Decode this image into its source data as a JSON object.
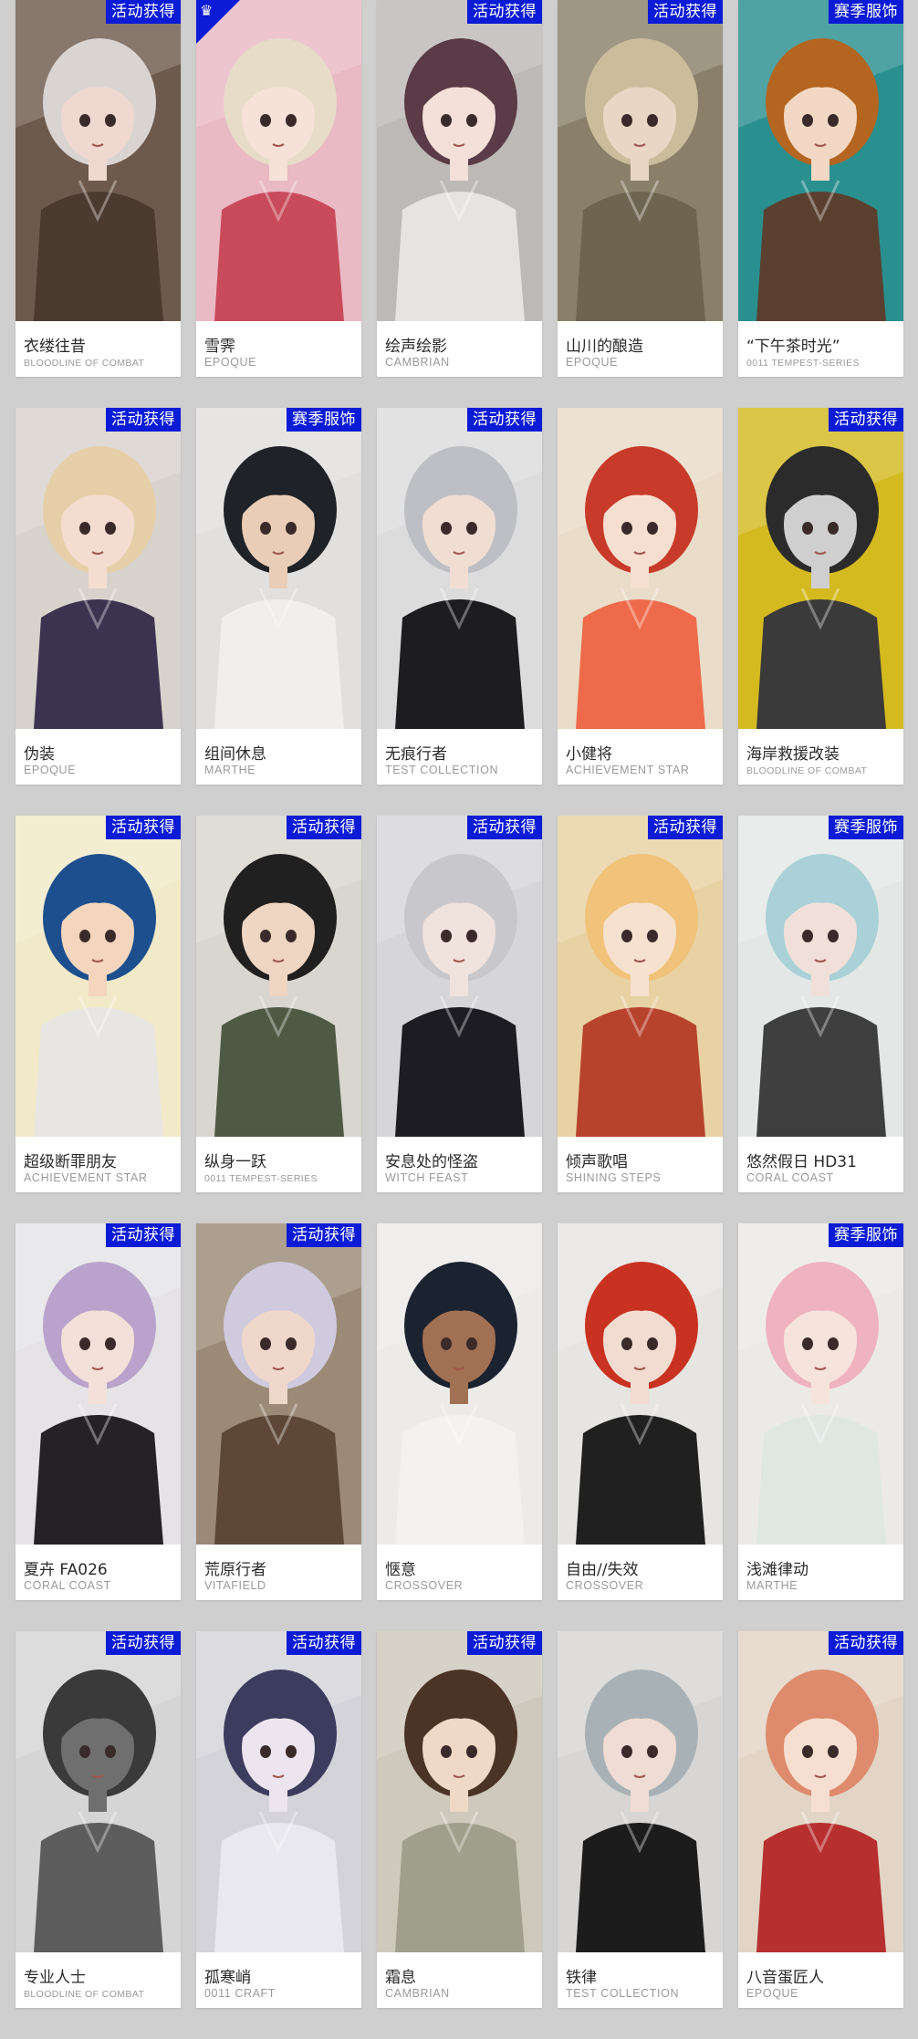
{
  "badges": {
    "event": "活动获得",
    "season": "赛季服饰"
  },
  "skins": [
    {
      "name": "衣缕往昔",
      "series": "BLOODLINE OF COMBAT",
      "badge": "活动获得",
      "bg": "#6e5a4c",
      "hair": "#d9d4d2",
      "outfit": "#4b3a30",
      "skin": "#efd8cf"
    },
    {
      "name": "雪霁",
      "series": "EPOQUE",
      "badge": "",
      "corner": true,
      "bg": "#e9b9c4",
      "hair": "#e6dcc8",
      "outfit": "#c94a5a",
      "skin": "#f6e2d8"
    },
    {
      "name": "绘声绘影",
      "series": "CAMBRIAN",
      "badge": "活动获得",
      "bg": "#bdb9b7",
      "hair": "#5a3b47",
      "outfit": "#e7e3e3",
      "skin": "#f4e0d8"
    },
    {
      "name": "山川的酿造",
      "series": "EPOQUE",
      "badge": "活动获得",
      "bg": "#8a8069",
      "hair": "#cbbd9c",
      "outfit": "#6f6450",
      "skin": "#ead6c4"
    },
    {
      "name": "“下午茶时光”",
      "series": "0011 TEMPEST-SERIES",
      "badge": "赛季服饰",
      "bg": "#2a8f8f",
      "hair": "#b4651f",
      "outfit": "#5b4030",
      "skin": "#f2d8c4"
    },
    {
      "name": "伪装",
      "series": "EPOQUE",
      "badge": "活动获得",
      "bg": "#d8d2cc",
      "hair": "#e6cfa8",
      "outfit": "#3b3450",
      "skin": "#f4ddd0"
    },
    {
      "name": "组间休息",
      "series": "MARTHE",
      "badge": "赛季服饰",
      "bg": "#e2e0de",
      "hair": "#1f2226",
      "outfit": "#f1efec",
      "skin": "#e9cdb7"
    },
    {
      "name": "无痕行者",
      "series": "TEST COLLECTION",
      "badge": "活动获得",
      "bg": "#dcdcdc",
      "hair": "#bdbfc4",
      "outfit": "#1d1d20",
      "skin": "#f1ded3"
    },
    {
      "name": "小健将",
      "series": "ACHIEVEMENT STAR",
      "badge": "",
      "bg": "#e9dcc8",
      "hair": "#c83a2a",
      "outfit": "#ee6a4a",
      "skin": "#f6dfd0"
    },
    {
      "name": "海岸救援改装",
      "series": "BLOODLINE OF COMBAT",
      "badge": "活动获得",
      "bg": "#d4ba1f",
      "hair": "#2b2b2b",
      "outfit": "#3a3a3a",
      "skin": "#cfcfcf"
    },
    {
      "name": "超级断罪朋友",
      "series": "ACHIEVEMENT STAR",
      "badge": "活动获得",
      "bg": "#f1e9c8",
      "hair": "#1d4f8e",
      "outfit": "#e8e6e2",
      "skin": "#f4d5be"
    },
    {
      "name": "纵身一跃",
      "series": "0011 TEMPEST-SERIES",
      "badge": "活动获得",
      "bg": "#d9d6cf",
      "hair": "#202020",
      "outfit": "#4f5a45",
      "skin": "#efd6c3"
    },
    {
      "name": "安息处的怪盗",
      "series": "WITCH FEAST",
      "badge": "活动获得",
      "bg": "#d6d6d8",
      "hair": "#c8c8cc",
      "outfit": "#1c1c22",
      "skin": "#f0e2dc"
    },
    {
      "name": "倾声歌唱",
      "series": "SHINING STEPS",
      "badge": "活动获得",
      "bg": "#e8d2a4",
      "hair": "#f0c27a",
      "outfit": "#b8432c",
      "skin": "#f6e1cf"
    },
    {
      "name": "悠然假日 HD31",
      "series": "CORAL COAST",
      "badge": "赛季服饰",
      "bg": "#e3e8e6",
      "hair": "#a9d1d7",
      "outfit": "#3f3f3f",
      "skin": "#f1e0d9"
    },
    {
      "name": "夏卉 FA026",
      "series": "CORAL COAST",
      "badge": "活动获得",
      "bg": "#e5e3e6",
      "hair": "#b9a3cc",
      "outfit": "#252227",
      "skin": "#f3e0d8"
    },
    {
      "name": "荒原行者",
      "series": "VITAFIELD",
      "badge": "活动获得",
      "bg": "#9a8a76",
      "hair": "#cfcadd",
      "outfit": "#5e4737",
      "skin": "#efd8cb"
    },
    {
      "name": "惬意",
      "series": "CROSSOVER",
      "badge": "",
      "bg": "#ecebe8",
      "hair": "#1b2230",
      "outfit": "#f3f2ef",
      "skin": "#a27052"
    },
    {
      "name": "自由//失效",
      "series": "CROSSOVER",
      "badge": "",
      "bg": "#e7e5e2",
      "hair": "#c93120",
      "outfit": "#202020",
      "skin": "#f2dcd2"
    },
    {
      "name": "浅滩律动",
      "series": "MARTHE",
      "badge": "赛季服饰",
      "bg": "#eceae6",
      "hair": "#efb2bf",
      "outfit": "#dfe7e3",
      "skin": "#f6e4dc"
    },
    {
      "name": "专业人士",
      "series": "BLOODLINE OF COMBAT",
      "badge": "活动获得",
      "bg": "#d5d5d5",
      "hair": "#3a3a3a",
      "outfit": "#5d5d5d",
      "skin": "#6f6f6f"
    },
    {
      "name": "孤寒峭",
      "series": "0011 CRAFT",
      "badge": "活动获得",
      "bg": "#d4d3da",
      "hair": "#3c3c5e",
      "outfit": "#e9e8ee",
      "skin": "#ece5ef"
    },
    {
      "name": "霜息",
      "series": "CAMBRIAN",
      "badge": "活动获得",
      "bg": "#cfc8bc",
      "hair": "#4b3426",
      "outfit": "#9fa08b",
      "skin": "#efd8c6"
    },
    {
      "name": "铁律",
      "series": "TEST COLLECTION",
      "badge": "",
      "bg": "#d7d6d4",
      "hair": "#a8b1b6",
      "outfit": "#1c1c1c",
      "skin": "#efdcd4"
    },
    {
      "name": "八音蛋匠人",
      "series": "EPOQUE",
      "badge": "活动获得",
      "bg": "#e2d5c5",
      "hair": "#de8a6d",
      "outfit": "#b72f2f",
      "skin": "#f6dfd0"
    }
  ]
}
